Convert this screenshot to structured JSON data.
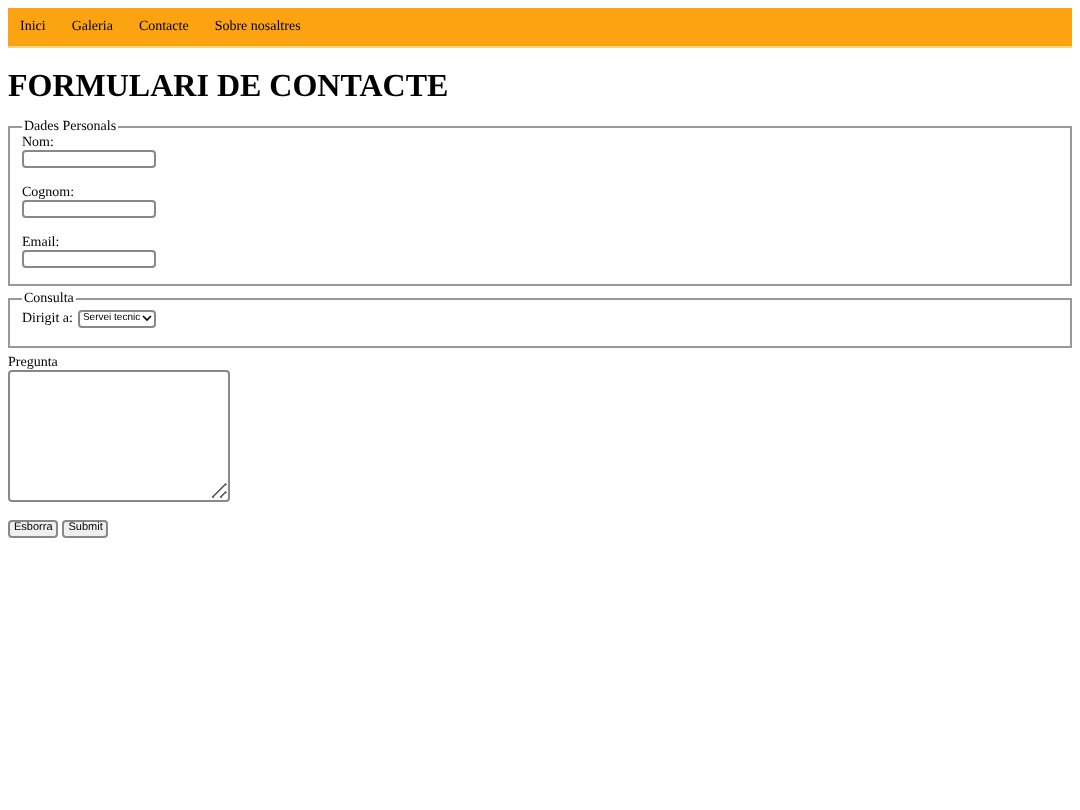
{
  "nav": {
    "items": [
      {
        "label": "Inici"
      },
      {
        "label": "Galeria"
      },
      {
        "label": "Contacte"
      },
      {
        "label": "Sobre nosaltres"
      }
    ]
  },
  "heading": "FORMULARI DE CONTACTE",
  "personal": {
    "legend": "Dades Personals",
    "fields": [
      {
        "label": "Nom:"
      },
      {
        "label": "Cognom:"
      },
      {
        "label": "Email:"
      }
    ]
  },
  "consulta": {
    "legend": "Consulta",
    "label": "Dirigit a:",
    "select_value": "Servei tecnic"
  },
  "question": {
    "label": "Pregunta"
  },
  "buttons": [
    "Esborra",
    "Submit"
  ]
}
